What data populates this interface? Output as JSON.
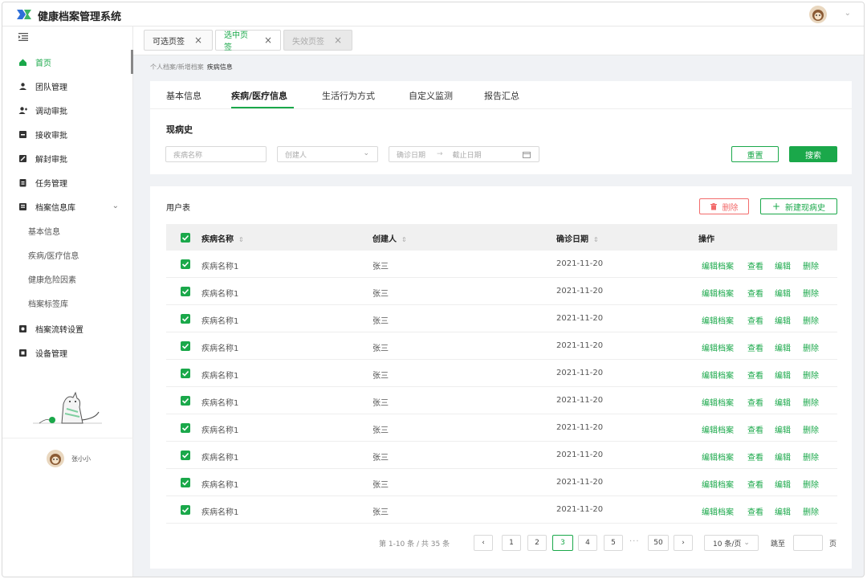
{
  "header": {
    "title": "健康档案管理系统"
  },
  "sidebar": {
    "items": [
      {
        "label": "首页",
        "icon": "home-icon",
        "active": true
      },
      {
        "label": "团队管理",
        "icon": "team-icon"
      },
      {
        "label": "调动审批",
        "icon": "user-transfer-icon"
      },
      {
        "label": "接收审批",
        "icon": "receive-icon"
      },
      {
        "label": "解封审批",
        "icon": "unseal-icon"
      },
      {
        "label": "任务管理",
        "icon": "task-icon"
      },
      {
        "label": "档案信息库",
        "icon": "archive-icon",
        "expanded": true
      }
    ],
    "sub_items": [
      "基本信息",
      "疾病/医疗信息",
      "健康危险因素",
      "档案标签库"
    ],
    "items_after": [
      {
        "label": "档案流转设置",
        "icon": "transfer-settings-icon"
      },
      {
        "label": "设备管理",
        "icon": "device-icon"
      }
    ],
    "user_name": "张小小"
  },
  "page_tabs": [
    {
      "label": "可选页签",
      "state": "normal"
    },
    {
      "label": "选中页签",
      "state": "selected"
    },
    {
      "label": "失效页签",
      "state": "disabled"
    }
  ],
  "breadcrumb": {
    "parent": "个人档案/新增档案",
    "current": "疾病信息"
  },
  "content_tabs": [
    "基本信息",
    "疾病/医疗信息",
    "生活行为方式",
    "自定义监测",
    "报告汇总"
  ],
  "active_content_tab": 1,
  "filter": {
    "section_title": "现病史",
    "disease_name": "疾病名称",
    "creator": "创建人",
    "start_date": "确诊日期",
    "end_date": "截止日期",
    "reset_label": "重置",
    "search_label": "搜索"
  },
  "table": {
    "title": "用户表",
    "delete_label": "删除",
    "new_label": "新建现病史",
    "columns": [
      "疾病名称",
      "创建人",
      "确诊日期",
      "操作"
    ],
    "actions": [
      "编辑档案",
      "查看",
      "编辑",
      "删除"
    ],
    "rows": [
      {
        "name": "疾病名称1",
        "creator": "张三",
        "date": "2021-11-20"
      },
      {
        "name": "疾病名称1",
        "creator": "张三",
        "date": "2021-11-20"
      },
      {
        "name": "疾病名称1",
        "creator": "张三",
        "date": "2021-11-20"
      },
      {
        "name": "疾病名称1",
        "creator": "张三",
        "date": "2021-11-20"
      },
      {
        "name": "疾病名称1",
        "creator": "张三",
        "date": "2021-11-20"
      },
      {
        "name": "疾病名称1",
        "creator": "张三",
        "date": "2021-11-20"
      },
      {
        "name": "疾病名称1",
        "creator": "张三",
        "date": "2021-11-20"
      },
      {
        "name": "疾病名称1",
        "creator": "张三",
        "date": "2021-11-20"
      },
      {
        "name": "疾病名称1",
        "creator": "张三",
        "date": "2021-11-20"
      },
      {
        "name": "疾病名称1",
        "creator": "张三",
        "date": "2021-11-20"
      }
    ]
  },
  "pagination": {
    "info": "第 1-10 条 / 共 35 条",
    "pages": [
      "1",
      "2",
      "3",
      "4",
      "5"
    ],
    "current": "3",
    "last": "50",
    "ellipsis": "···",
    "page_size": "10 条/页",
    "jump_label": "跳至",
    "page_unit": "页"
  },
  "colors": {
    "accent": "#1aa84a",
    "danger": "#f26b6b"
  }
}
